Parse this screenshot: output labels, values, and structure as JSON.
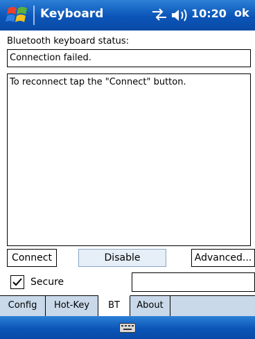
{
  "titlebar": {
    "title": "Keyboard",
    "time": "10:20",
    "ok_label": "ok",
    "icons": [
      "windows-start-icon",
      "connectivity-icon",
      "volume-icon"
    ]
  },
  "status": {
    "label": "Bluetooth keyboard status:",
    "value": "Connection failed."
  },
  "message": "To reconnect tap the \"Connect\" button.",
  "buttons": {
    "connect": "Connect",
    "disable": "Disable",
    "advanced": "Advanced..."
  },
  "secure": {
    "label": "Secure",
    "checked": true,
    "input_value": ""
  },
  "tabs": [
    {
      "label": "Config",
      "active": false
    },
    {
      "label": "Hot-Key",
      "active": false
    },
    {
      "label": "BT",
      "active": true
    },
    {
      "label": "About",
      "active": false
    }
  ],
  "menubar": {
    "icon": "keyboard-icon"
  },
  "colors": {
    "titlebar": "#0b55b8",
    "tabbar": "#c9d9ea",
    "disabled_button": "#e6eef7"
  }
}
